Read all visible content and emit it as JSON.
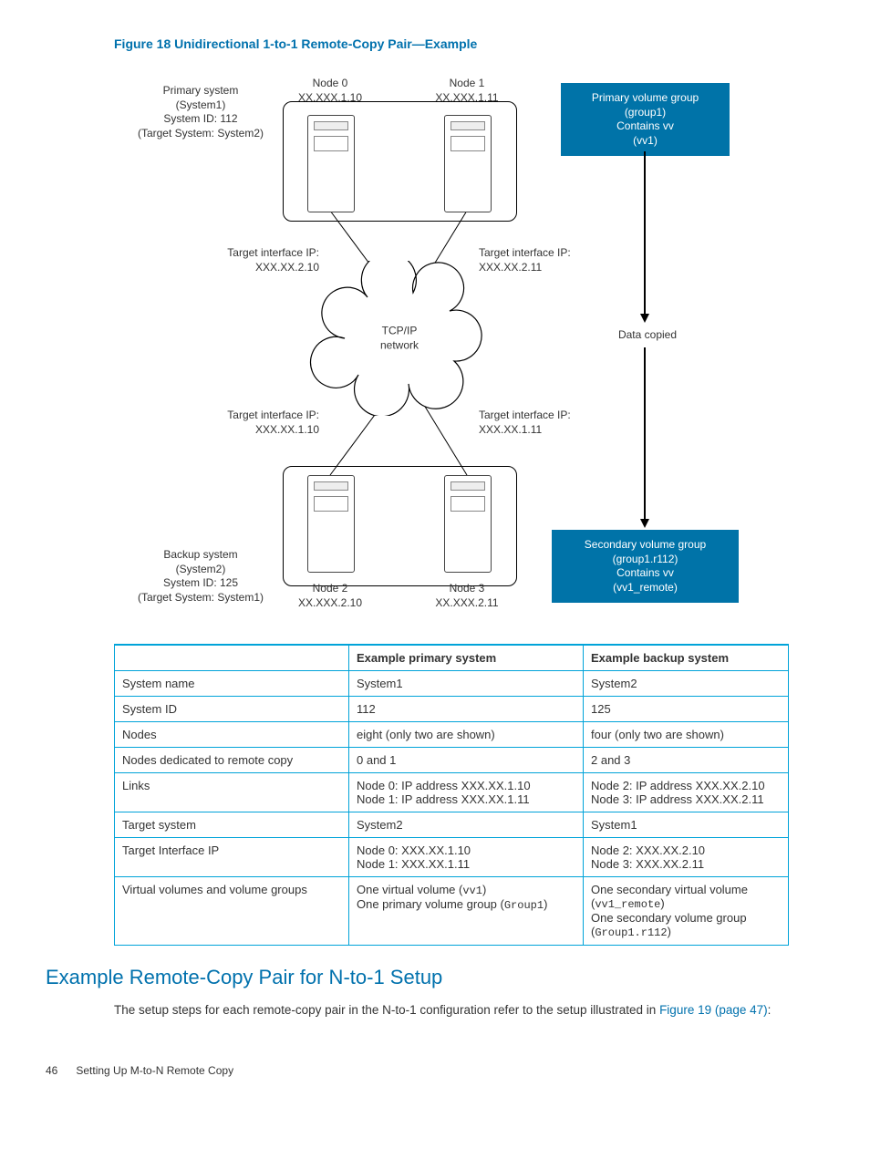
{
  "figure_title": "Figure 18 Unidirectional 1-to-1 Remote-Copy Pair—Example",
  "diagram": {
    "primary_system": {
      "lines": [
        "Primary system",
        "(System1)",
        "System ID: 112",
        "(Target System: System2)"
      ]
    },
    "backup_system": {
      "lines": [
        "Backup system",
        "(System2)",
        "System ID: 125",
        "(Target System: System1)"
      ]
    },
    "nodes": {
      "n0": {
        "name": "Node 0",
        "ip": "XX.XXX.1.10"
      },
      "n1": {
        "name": "Node 1",
        "ip": "XX.XXX.1.11"
      },
      "n2": {
        "name": "Node 2",
        "ip": "XX.XXX.2.10"
      },
      "n3": {
        "name": "Node 3",
        "ip": "XX.XXX.2.11"
      }
    },
    "target_if": {
      "top_left": {
        "label": "Target interface IP:",
        "ip": "XXX.XX.2.10"
      },
      "top_right": {
        "label": "Target interface IP:",
        "ip": "XXX.XX.2.11"
      },
      "bot_left": {
        "label": "Target interface IP:",
        "ip": "XXX.XX.1.10"
      },
      "bot_right": {
        "label": "Target interface IP:",
        "ip": "XXX.XX.1.11"
      }
    },
    "cloud": "TCP/IP\nnetwork",
    "data_copied": "Data copied",
    "primary_vg": {
      "lines": [
        "Primary volume group",
        "(group1)",
        "Contains vv",
        "(vv1)"
      ]
    },
    "secondary_vg": {
      "lines": [
        "Secondary volume group",
        "(group1.r112)",
        "Contains vv",
        "(vv1_remote)"
      ]
    }
  },
  "table": {
    "headers": [
      "",
      "Example primary system",
      "Example backup system"
    ],
    "rows": [
      {
        "label": "System name",
        "primary": "System1",
        "backup": "System2"
      },
      {
        "label": "System ID",
        "primary": "112",
        "backup": "125"
      },
      {
        "label": "Nodes",
        "primary": "eight (only two are shown)",
        "backup": "four (only two are shown)"
      },
      {
        "label": "Nodes dedicated to remote copy",
        "primary": "0 and 1",
        "backup": "2 and 3"
      },
      {
        "label": "Links",
        "primary": "Node 0: IP address XXX.XX.1.10\nNode 1: IP address XXX.XX.1.11",
        "backup": "Node 2: IP address XXX.XX.2.10\nNode 3: IP address XXX.XX.2.11"
      },
      {
        "label": "Target system",
        "primary": "System2",
        "backup": "System1"
      },
      {
        "label": "Target Interface IP",
        "primary": "Node 0: XXX.XX.1.10\nNode 1: XXX.XX.1.11",
        "backup": "Node 2: XXX.XX.2.10\nNode 3: XXX.XX.2.11"
      },
      {
        "label": "Virtual volumes and volume groups",
        "primary_html": "One virtual volume (<span class='mono'>vv1</span>)<br>One primary volume group (<span class='mono'>Group1</span>)",
        "backup_html": "One secondary virtual volume (<span class='mono'>vv1_remote</span>)<br>One secondary volume group (<span class='mono'>Group1.r112</span>)"
      }
    ]
  },
  "section_heading": "Example Remote-Copy Pair for N-to-1 Setup",
  "body_para_pre": "The setup steps for each remote-copy pair in the N-to-1 configuration refer to the setup illustrated in ",
  "body_link": "Figure 19 (page 47)",
  "body_para_post": ":",
  "footer": {
    "page": "46",
    "title": "Setting Up M-to-N Remote Copy"
  }
}
